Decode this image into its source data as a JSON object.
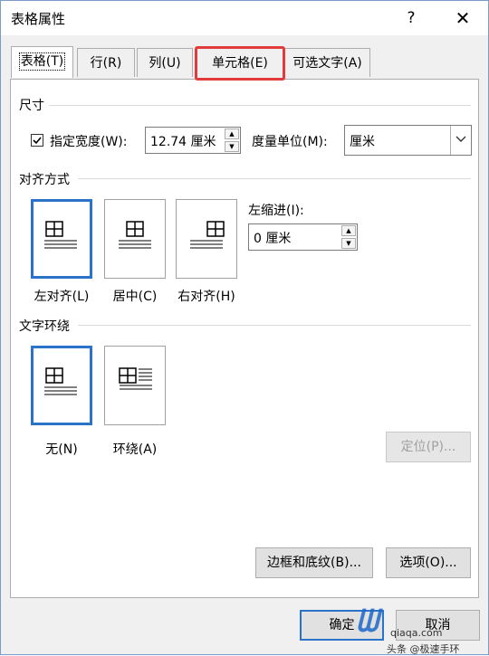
{
  "window": {
    "title": "表格属性",
    "help_glyph": "?",
    "close_glyph": "✕"
  },
  "tabs": [
    {
      "label": "表格(T)",
      "active": true
    },
    {
      "label": "行(R)",
      "active": false
    },
    {
      "label": "列(U)",
      "active": false
    },
    {
      "label": "单元格(E)",
      "active": false,
      "highlighted": true
    },
    {
      "label": "可选文字(A)",
      "active": false
    }
  ],
  "size": {
    "heading": "尺寸",
    "width_checkbox_label": "指定宽度(W):",
    "width_checked": true,
    "width_value": "12.74 厘米",
    "unit_label": "度量单位(M):",
    "unit_value": "厘米"
  },
  "alignment": {
    "heading": "对齐方式",
    "options": [
      {
        "label": "左对齐(L)",
        "selected": true
      },
      {
        "label": "居中(C)",
        "selected": false
      },
      {
        "label": "右对齐(H)",
        "selected": false
      }
    ],
    "indent_label": "左缩进(I):",
    "indent_value": "0 厘米"
  },
  "wrapping": {
    "heading": "文字环绕",
    "options": [
      {
        "label": "无(N)",
        "selected": true
      },
      {
        "label": "环绕(A)",
        "selected": false
      }
    ],
    "position_button": "定位(P)..."
  },
  "buttons": {
    "borders": "边框和底纹(B)...",
    "options": "选项(O)...",
    "ok": "确定",
    "cancel": "取消"
  },
  "watermark": {
    "logo_text": "qiaqa.com",
    "caption": "头条 @极速手环"
  },
  "colors": {
    "accent": "#2b73c8",
    "highlight": "#e23b3b"
  }
}
